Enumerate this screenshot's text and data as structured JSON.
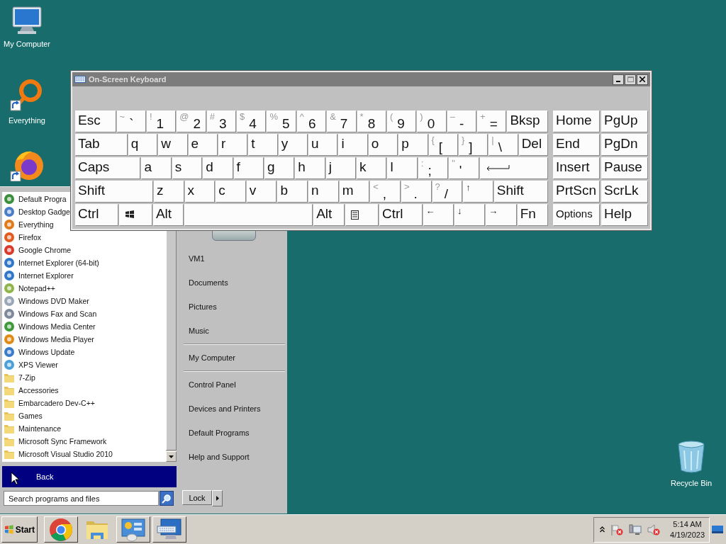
{
  "desktop_icons": [
    {
      "kind": "computer",
      "label": "My Computer"
    },
    {
      "kind": "everything",
      "label": "Everything"
    },
    {
      "kind": "firefox"
    },
    {
      "kind": "recycle",
      "label": "Recycle Bin"
    }
  ],
  "keyboard_window": {
    "title": "On-Screen Keyboard",
    "key_rows": [
      {
        "keys": [
          {
            "kind": "text",
            "label": "Esc"
          },
          {
            "kind": "dual",
            "shift": "~",
            "label": "`"
          },
          {
            "kind": "dual",
            "shift": "!",
            "label": "1"
          },
          {
            "kind": "dual",
            "shift": "@",
            "label": "2"
          },
          {
            "kind": "dual",
            "shift": "#",
            "label": "3"
          },
          {
            "kind": "dual",
            "shift": "$",
            "label": "4"
          },
          {
            "kind": "dual",
            "shift": "%",
            "label": "5"
          },
          {
            "kind": "dual",
            "shift": "^",
            "label": "6"
          },
          {
            "kind": "dual",
            "shift": "&",
            "label": "7"
          },
          {
            "kind": "dual",
            "shift": "*",
            "label": "8"
          },
          {
            "kind": "dual",
            "shift": "(",
            "label": "9"
          },
          {
            "kind": "dual",
            "shift": ")",
            "label": "0"
          },
          {
            "kind": "dual",
            "shift": "–",
            "label": "-"
          },
          {
            "kind": "dual",
            "shift": "+",
            "label": "="
          },
          {
            "kind": "text",
            "label": "Bksp"
          }
        ]
      },
      {
        "keys": [
          {
            "kind": "text",
            "label": "Tab"
          },
          {
            "kind": "text",
            "label": "q"
          },
          {
            "kind": "text",
            "label": "w"
          },
          {
            "kind": "text",
            "label": "e"
          },
          {
            "kind": "text",
            "label": "r"
          },
          {
            "kind": "text",
            "label": "t"
          },
          {
            "kind": "text",
            "label": "y"
          },
          {
            "kind": "text",
            "label": "u"
          },
          {
            "kind": "text",
            "label": "i"
          },
          {
            "kind": "text",
            "label": "o"
          },
          {
            "kind": "text",
            "label": "p"
          },
          {
            "kind": "dual",
            "shift": "{",
            "label": "["
          },
          {
            "kind": "dual",
            "shift": "}",
            "label": "]"
          },
          {
            "kind": "dual",
            "shift": "|",
            "label": "\\"
          },
          {
            "kind": "text",
            "label": "Del"
          }
        ]
      },
      {
        "keys": [
          {
            "kind": "text",
            "label": "Caps"
          },
          {
            "kind": "text",
            "label": "a"
          },
          {
            "kind": "text",
            "label": "s"
          },
          {
            "kind": "text",
            "label": "d"
          },
          {
            "kind": "text",
            "label": "f"
          },
          {
            "kind": "text",
            "label": "g"
          },
          {
            "kind": "text",
            "label": "h"
          },
          {
            "kind": "text",
            "label": "j"
          },
          {
            "kind": "text",
            "label": "k"
          },
          {
            "kind": "text",
            "label": "l"
          },
          {
            "kind": "dual",
            "shift": ":",
            "label": ";"
          },
          {
            "kind": "dual",
            "shift": "\"",
            "label": "'"
          },
          {
            "kind": "enter"
          }
        ]
      },
      {
        "keys": [
          {
            "kind": "text",
            "label": "Shift"
          },
          {
            "kind": "text",
            "label": "z"
          },
          {
            "kind": "text",
            "label": "x"
          },
          {
            "kind": "text",
            "label": "c"
          },
          {
            "kind": "text",
            "label": "v"
          },
          {
            "kind": "text",
            "label": "b"
          },
          {
            "kind": "text",
            "label": "n"
          },
          {
            "kind": "text",
            "label": "m"
          },
          {
            "kind": "dual",
            "shift": "<",
            "label": ","
          },
          {
            "kind": "dual",
            "shift": ">",
            "label": "."
          },
          {
            "kind": "dual",
            "shift": "?",
            "label": "/"
          },
          {
            "kind": "small",
            "label": "↑"
          },
          {
            "kind": "text",
            "label": "Shift"
          }
        ]
      },
      {
        "keys": [
          {
            "kind": "text",
            "label": "Ctrl"
          },
          {
            "kind": "windows"
          },
          {
            "kind": "text",
            "label": "Alt"
          },
          {
            "kind": "space"
          },
          {
            "kind": "text",
            "label": "Alt"
          },
          {
            "kind": "menu"
          },
          {
            "kind": "text",
            "label": "Ctrl"
          },
          {
            "kind": "small",
            "label": "←"
          },
          {
            "kind": "small",
            "label": "↓"
          },
          {
            "kind": "small",
            "label": "→"
          },
          {
            "kind": "text",
            "label": "Fn"
          }
        ]
      }
    ],
    "nav_rows": [
      [
        {
          "kind": "text",
          "label": "Home"
        },
        {
          "kind": "text",
          "label": "PgUp"
        }
      ],
      [
        {
          "kind": "text",
          "label": "End"
        },
        {
          "kind": "text",
          "label": "PgDn"
        }
      ],
      [
        {
          "kind": "text",
          "label": "Insert"
        },
        {
          "kind": "text",
          "label": "Pause"
        }
      ],
      [
        {
          "kind": "text",
          "label": "PrtScn"
        },
        {
          "kind": "text",
          "label": "ScrLk"
        }
      ],
      [
        {
          "kind": "options",
          "label": "Options"
        },
        {
          "kind": "text",
          "label": "Help"
        }
      ]
    ]
  },
  "start_menu": {
    "programs": [
      {
        "kind": "program",
        "label": "Default Progra"
      },
      {
        "kind": "program",
        "label": "Desktop Gadge"
      },
      {
        "kind": "program",
        "label": "Everything"
      },
      {
        "kind": "program",
        "label": "Firefox"
      },
      {
        "kind": "program",
        "label": "Google Chrome"
      },
      {
        "kind": "program",
        "label": "Internet Explorer (64-bit)"
      },
      {
        "kind": "program",
        "label": "Internet Explorer"
      },
      {
        "kind": "program",
        "label": "Notepad++"
      },
      {
        "kind": "program",
        "label": "Windows DVD Maker"
      },
      {
        "kind": "program",
        "label": "Windows Fax and Scan"
      },
      {
        "kind": "program",
        "label": "Windows Media Center"
      },
      {
        "kind": "program",
        "label": "Windows Media Player"
      },
      {
        "kind": "program",
        "label": "Windows Update"
      },
      {
        "kind": "program",
        "label": "XPS Viewer"
      },
      {
        "kind": "folder",
        "label": "7-Zip"
      },
      {
        "kind": "folder",
        "label": "Accessories"
      },
      {
        "kind": "folder",
        "label": "Embarcadero Dev-C++"
      },
      {
        "kind": "folder",
        "label": "Games"
      },
      {
        "kind": "folder",
        "label": "Maintenance"
      },
      {
        "kind": "folder",
        "label": "Microsoft Sync Framework"
      },
      {
        "kind": "folder",
        "label": "Microsoft Visual Studio 2010"
      }
    ],
    "back": "Back",
    "search": {
      "placeholder": "Search programs and files"
    },
    "place_groups": [
      [
        "VM1",
        "Documents",
        "Pictures",
        "Music"
      ],
      [
        "My Computer"
      ],
      [
        "Control Panel",
        "Devices and Printers",
        "Default Programs",
        "Help and Support"
      ]
    ],
    "lock": "Lock"
  },
  "taskbar": {
    "start": "Start",
    "apps": [
      {
        "kind": "chrome",
        "running": true
      },
      {
        "kind": "explorer",
        "running": false
      },
      {
        "kind": "control-panel",
        "running": true
      },
      {
        "kind": "keyboard",
        "running": true
      }
    ],
    "clock": {
      "time": "5:14 AM",
      "date": "4/19/2023"
    }
  }
}
